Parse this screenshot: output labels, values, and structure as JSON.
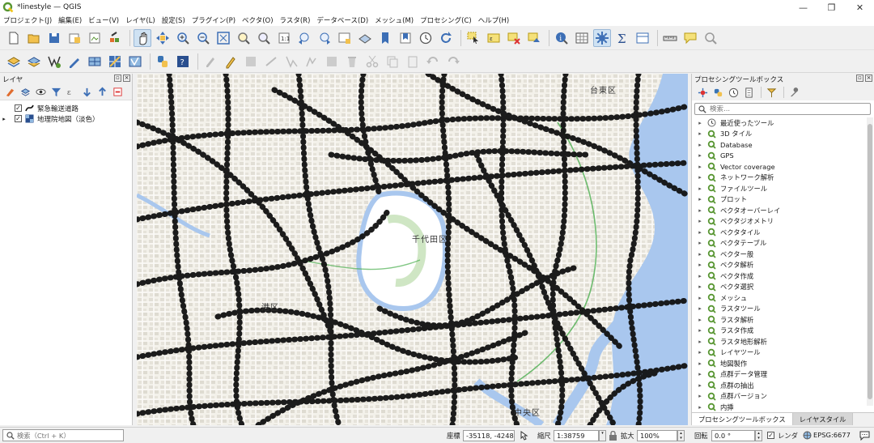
{
  "window": {
    "title": "*linestyle — QGIS",
    "minimize": "—",
    "maximize": "❐",
    "close": "✕"
  },
  "menu": [
    "プロジェクト(J)",
    "編集(E)",
    "ビュー(V)",
    "レイヤ(L)",
    "設定(S)",
    "プラグイン(P)",
    "ベクタ(O)",
    "ラスタ(R)",
    "データベース(D)",
    "メッシュ(M)",
    "プロセシング(C)",
    "ヘルプ(H)"
  ],
  "layers_panel": {
    "title": "レイヤ",
    "layers": [
      {
        "name": "緊急輸送道路",
        "checked": "✓"
      },
      {
        "name": "地理院地図（淡色）",
        "checked": "✓",
        "expander": "▸"
      }
    ]
  },
  "map": {
    "labels": [
      "千代田区",
      "港区",
      "中央区",
      "台東区"
    ]
  },
  "toolbox": {
    "title": "プロセシングツールボックス",
    "search_placeholder": "検索...",
    "items": [
      "最近使ったツール",
      "3D タイル",
      "Database",
      "GPS",
      "Vector coverage",
      "ネットワーク解析",
      "ファイルツール",
      "プロット",
      "ベクタオーバーレイ",
      "ベクタジオメトリ",
      "ベクタタイル",
      "ベクタテーブル",
      "ベクター般",
      "ベクタ解析",
      "ベクタ作成",
      "ベクタ選択",
      "メッシュ",
      "ラスタツール",
      "ラスタ解析",
      "ラスタ作成",
      "ラスタ地形解析",
      "レイヤツール",
      "地図製作",
      "点群データ管理",
      "点群の抽出",
      "点群バージョン",
      "内挿"
    ],
    "tabs": [
      "プロセシングツールボックス",
      "レイヤスタイル"
    ]
  },
  "statusbar": {
    "locator_placeholder": "検索（Ctrl + K）",
    "coord_label": "座標",
    "coord_value": "-35118, -4248",
    "scale_label": "縮尺",
    "scale_value": "1:38759",
    "magnifier_label": "拡大",
    "magnifier_value": "100%",
    "rotation_label": "回転",
    "rotation_value": "0.0 °",
    "render_label": "レンダ",
    "render_checked": "✓",
    "crs": "EPSG:6677"
  },
  "colors": {
    "qgis_green": "#589632",
    "water": "#a9c7ee",
    "road_black": "#111111"
  }
}
